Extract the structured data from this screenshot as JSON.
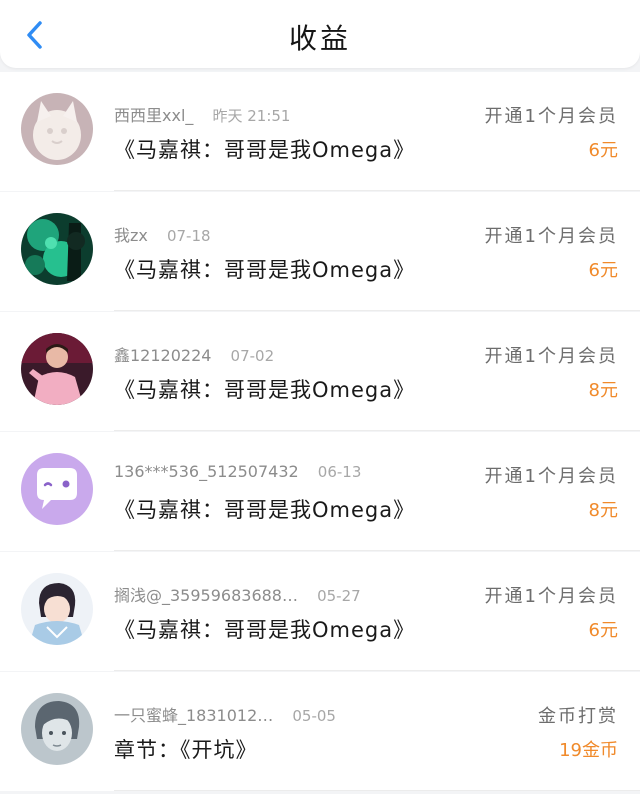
{
  "header": {
    "title": "收益",
    "back_icon": "back-arrow-icon",
    "accent_color": "#2f8cf4"
  },
  "entries": [
    {
      "username": "西西里xxl_",
      "date": "昨天 21:51",
      "work": "《马嘉祺：哥哥是我Omega》",
      "type": "开通1个月会员",
      "amount": "6元",
      "avatar_icon": "white-cat-avatar-icon"
    },
    {
      "username": "我zx",
      "date": "07-18",
      "work": "《马嘉祺：哥哥是我Omega》",
      "type": "开通1个月会员",
      "amount": "6元",
      "avatar_icon": "green-glow-avatar-icon"
    },
    {
      "username": "鑫12120224",
      "date": "07-02",
      "work": "《马嘉祺：哥哥是我Omega》",
      "type": "开通1个月会员",
      "amount": "8元",
      "avatar_icon": "pink-person-avatar-icon"
    },
    {
      "username": "136***536_512507432",
      "date": "06-13",
      "work": "《马嘉祺：哥哥是我Omega》",
      "type": "开通1个月会员",
      "amount": "8元",
      "avatar_icon": "chat-bubble-avatar-icon"
    },
    {
      "username": "搁浅@_35959683688…",
      "date": "05-27",
      "work": "《马嘉祺：哥哥是我Omega》",
      "type": "开通1个月会员",
      "amount": "6元",
      "avatar_icon": "anime-avatar-icon"
    },
    {
      "username": "一只蜜蜂_1831012…",
      "date": "05-05",
      "work": "章节：《开坑》",
      "type": "金币打赏",
      "amount": "19金币",
      "avatar_icon": "sketch-portrait-avatar-icon"
    }
  ],
  "colors": {
    "amount": "#f08a2b",
    "background": "#f3f4f6"
  }
}
